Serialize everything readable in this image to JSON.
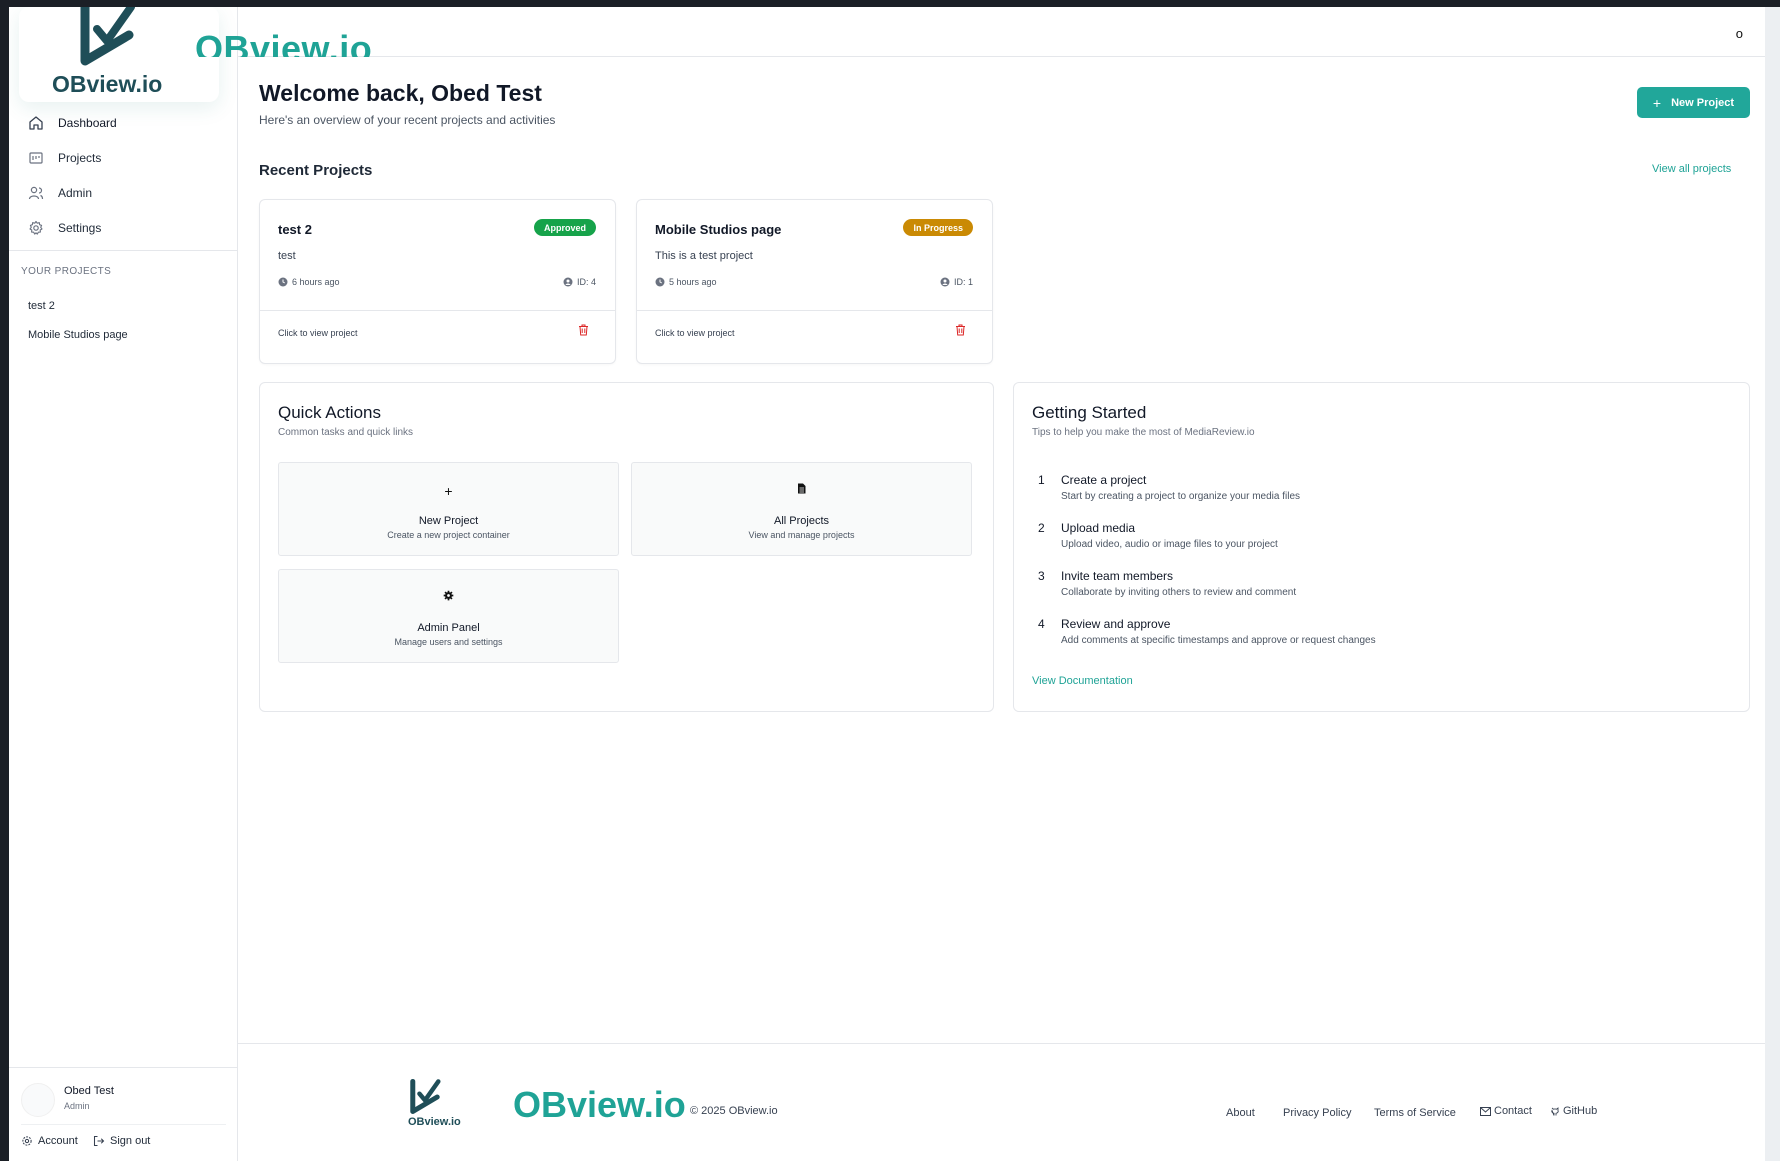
{
  "app": {
    "logo_text": "OBview.io",
    "brand_overflow_text": "OBview.io",
    "top_right_glyph": "o"
  },
  "colors": {
    "accent": "#21a79a",
    "approved": "#16a34a",
    "in_progress": "#ca8a04",
    "danger": "#dc2626"
  },
  "sidebar": {
    "nav": [
      {
        "label": "Dashboard",
        "icon": "home-icon"
      },
      {
        "label": "Projects",
        "icon": "projects-icon"
      },
      {
        "label": "Admin",
        "icon": "users-icon"
      },
      {
        "label": "Settings",
        "icon": "gear-icon"
      }
    ],
    "section_title": "YOUR PROJECTS",
    "projects": [
      "test 2",
      "Mobile Studios page"
    ],
    "user": {
      "name": "Obed Test",
      "role": "Admin"
    },
    "account_label": "Account",
    "signout_label": "Sign out"
  },
  "header": {
    "welcome": "Welcome back, Obed Test",
    "subtitle": "Here's an overview of your recent projects and activities",
    "new_project_label": "New Project"
  },
  "recent": {
    "title": "Recent Projects",
    "view_all": "View all projects",
    "cards": [
      {
        "title": "test 2",
        "description": "test",
        "status": "Approved",
        "time": "6 hours ago",
        "id": "ID: 4",
        "footer": "Click to view project"
      },
      {
        "title": "Mobile Studios page",
        "description": "This is a test project",
        "status": "In Progress",
        "time": "5 hours ago",
        "id": "ID: 1",
        "footer": "Click to view project"
      }
    ]
  },
  "quick_actions": {
    "title": "Quick Actions",
    "subtitle": "Common tasks and quick links",
    "tiles": [
      {
        "title": "New Project",
        "subtitle": "Create a new project container",
        "icon": "plus-icon"
      },
      {
        "title": "All Projects",
        "subtitle": "View and manage projects",
        "icon": "document-icon"
      },
      {
        "title": "Admin Panel",
        "subtitle": "Manage users and settings",
        "icon": "gear-icon"
      }
    ]
  },
  "getting_started": {
    "title": "Getting Started",
    "subtitle": "Tips to help you make the most of MediaReview.io",
    "steps": [
      {
        "num": "1",
        "title": "Create a project",
        "desc": "Start by creating a project to organize your media files"
      },
      {
        "num": "2",
        "title": "Upload media",
        "desc": "Upload video, audio or image files to your project"
      },
      {
        "num": "3",
        "title": "Invite team members",
        "desc": "Collaborate by inviting others to review and comment"
      },
      {
        "num": "4",
        "title": "Review and approve",
        "desc": "Add comments at specific timestamps and approve or request changes"
      }
    ],
    "link": "View Documentation"
  },
  "footer": {
    "logo_small": "OBview.io",
    "brand": "OBview.io",
    "copyright": "© 2025 OBview.io",
    "links": [
      "About",
      "Privacy Policy",
      "Terms of Service",
      "Contact",
      "GitHub"
    ]
  }
}
